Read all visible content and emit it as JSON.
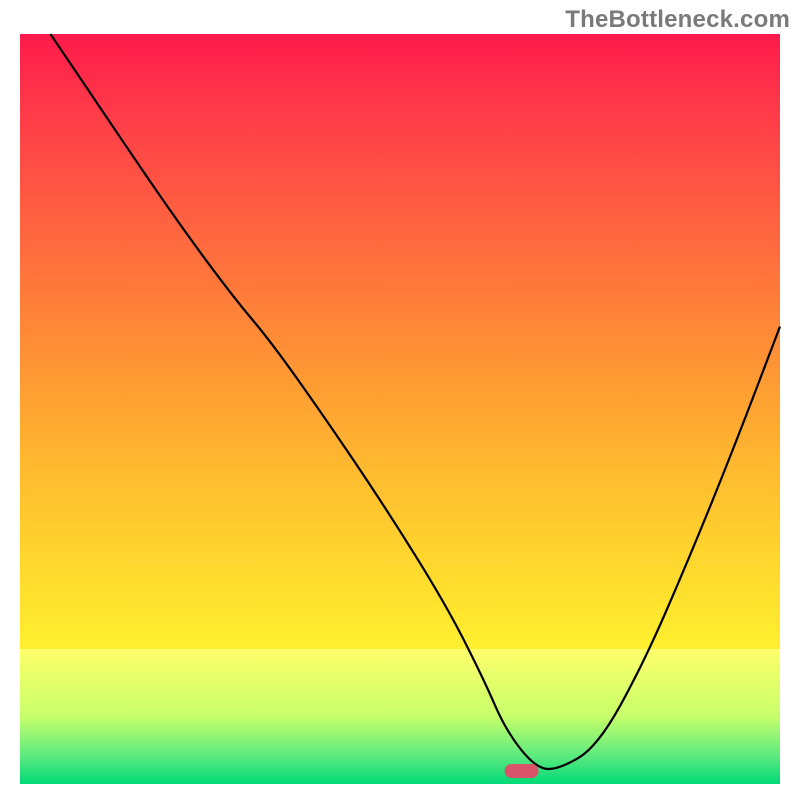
{
  "watermark": "TheBottleneck.com",
  "chart_data": {
    "type": "line",
    "title": "",
    "xlabel": "",
    "ylabel": "",
    "xlim": [
      0,
      100
    ],
    "ylim": [
      0,
      100
    ],
    "grid": false,
    "annotations": [
      {
        "type": "marker",
        "x": 66,
        "y": 2,
        "shape": "pill",
        "color": "#d9536a"
      }
    ],
    "series": [
      {
        "name": "bottleneck-curve",
        "x": [
          4,
          10,
          20,
          28,
          33,
          40,
          48,
          56,
          61,
          64,
          68,
          71,
          76,
          82,
          88,
          94,
          100
        ],
        "y": [
          100,
          91,
          76,
          65,
          59,
          49,
          37,
          24,
          14,
          7,
          2,
          2,
          5,
          16,
          30,
          45,
          61
        ]
      }
    ],
    "background_gradient": {
      "stops": [
        {
          "pos": 0.0,
          "color": "#ff1a4b"
        },
        {
          "pos": 0.5,
          "color": "#ff9a33"
        },
        {
          "pos": 0.82,
          "color": "#ffff48"
        },
        {
          "pos": 0.96,
          "color": "#57e97f"
        },
        {
          "pos": 1.0,
          "color": "#00d977"
        }
      ]
    }
  }
}
